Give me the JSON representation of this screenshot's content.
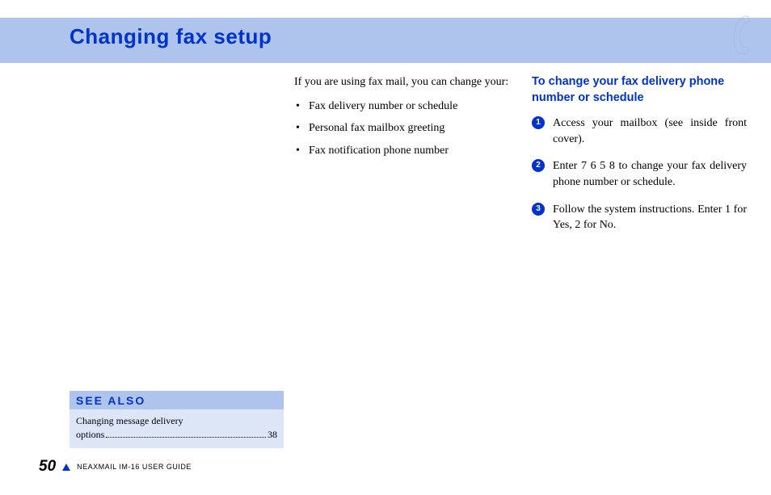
{
  "header": {
    "title": "Changing fax setup"
  },
  "main": {
    "intro": "If you are using fax mail, you can change your:",
    "bullets": [
      "Fax delivery number or schedule",
      "Personal fax mailbox greeting",
      "Fax notification phone number"
    ],
    "subhead": "To change your fax delivery phone number or schedule",
    "steps": [
      "Access your mailbox (see inside front cover).",
      "Enter 7 6 5 8 to change your fax delivery phone number or schedule.",
      "Follow the system instructions. Enter 1 for Yes, 2 for No."
    ]
  },
  "see_also": {
    "title": "SEE ALSO",
    "item_line1": "Changing message delivery",
    "item_line2": "options",
    "page": "38"
  },
  "footer": {
    "page_number": "50",
    "guide": "NEAXMAIL IM-16 USER GUIDE"
  }
}
